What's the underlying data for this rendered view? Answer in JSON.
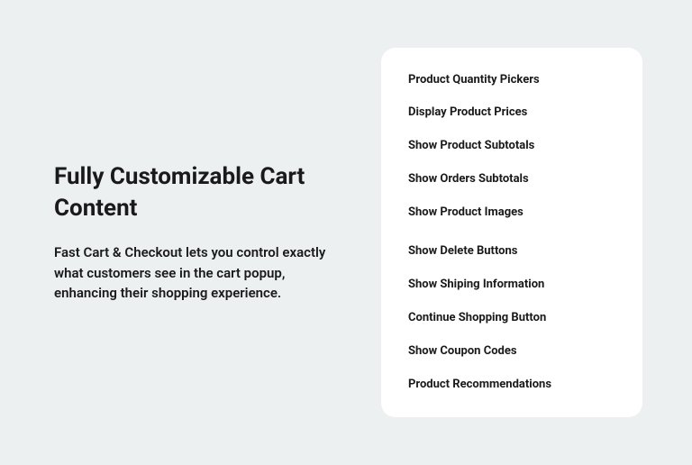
{
  "hero": {
    "heading": "Fully Customizable Cart Content",
    "description": "Fast Cart & Checkout lets you control exactly what customers see in the cart popup, enhancing their shopping experience."
  },
  "features": {
    "items": [
      "Product Quantity Pickers",
      "Display Product Prices",
      "Show Product Subtotals",
      "Show Orders Subtotals",
      "Show Product Images",
      "Show Delete Buttons",
      "Show Shiping Information",
      "Continue Shopping Button",
      "Show Coupon Codes",
      "Product Recommendations"
    ]
  }
}
